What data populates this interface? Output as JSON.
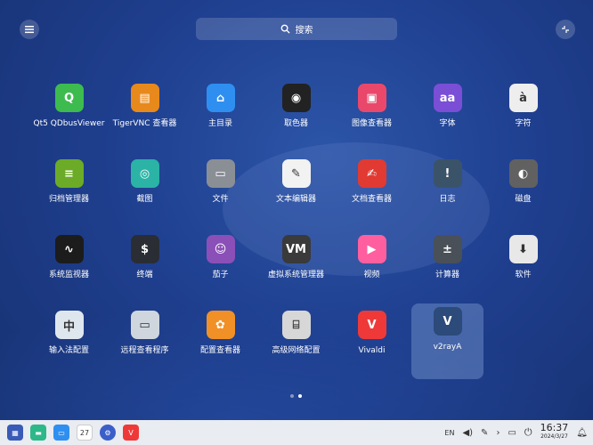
{
  "search": {
    "label": "搜索"
  },
  "apps": [
    {
      "label": "Qt5 QDbusViewer",
      "icon": "qt-icon",
      "color": "#3dbb4f",
      "glyph": "Q"
    },
    {
      "label": "TigerVNC 查看器",
      "icon": "tigervnc-icon",
      "color": "#e8891c",
      "glyph": "▤"
    },
    {
      "label": "主目录",
      "icon": "home-folder-icon",
      "color": "#2f8ff0",
      "glyph": "⌂"
    },
    {
      "label": "取色器",
      "icon": "color-picker-icon",
      "color": "#222222",
      "glyph": "◉"
    },
    {
      "label": "图像查看器",
      "icon": "image-viewer-icon",
      "color": "#e9486b",
      "glyph": "▣"
    },
    {
      "label": "字体",
      "icon": "font-icon",
      "color": "#7a4fd6",
      "glyph": "aa"
    },
    {
      "label": "字符",
      "icon": "character-map-icon",
      "color": "#eeeeee",
      "glyph": "à"
    },
    {
      "label": "归档管理器",
      "icon": "archive-manager-icon",
      "color": "#6cab27",
      "glyph": "≡"
    },
    {
      "label": "截图",
      "icon": "screenshot-icon",
      "color": "#2bb3a6",
      "glyph": "◎"
    },
    {
      "label": "文件",
      "icon": "files-icon",
      "color": "#8a8f96",
      "glyph": "▭"
    },
    {
      "label": "文本编辑器",
      "icon": "text-editor-icon",
      "color": "#f2f2f2",
      "glyph": "✎"
    },
    {
      "label": "文档查看器",
      "icon": "document-viewer-icon",
      "color": "#e13a33",
      "glyph": "✍"
    },
    {
      "label": "日志",
      "icon": "logs-icon",
      "color": "#3b5368",
      "glyph": "!"
    },
    {
      "label": "磁盘",
      "icon": "disks-icon",
      "color": "#616161",
      "glyph": "◐"
    },
    {
      "label": "系统监视器",
      "icon": "system-monitor-icon",
      "color": "#1c1c1c",
      "glyph": "∿"
    },
    {
      "label": "终端",
      "icon": "terminal-icon",
      "color": "#2a2d33",
      "glyph": "$"
    },
    {
      "label": "茄子",
      "icon": "cheese-icon",
      "color": "#8b4fb8",
      "glyph": "☺"
    },
    {
      "label": "虚拟系统管理器",
      "icon": "virt-manager-icon",
      "color": "#3a3a3a",
      "glyph": "VM"
    },
    {
      "label": "视频",
      "icon": "videos-icon",
      "color": "#ff5f9e",
      "glyph": "▶"
    },
    {
      "label": "计算器",
      "icon": "calculator-icon",
      "color": "#495057",
      "glyph": "±"
    },
    {
      "label": "软件",
      "icon": "software-icon",
      "color": "#e8e8e8",
      "glyph": "⬇"
    },
    {
      "label": "输入法配置",
      "icon": "input-method-icon",
      "color": "#dfe7ee",
      "glyph": "中"
    },
    {
      "label": "远程查看程序",
      "icon": "remote-viewer-icon",
      "color": "#cfd6de",
      "glyph": "▭"
    },
    {
      "label": "配置查看器",
      "icon": "config-viewer-icon",
      "color": "#f19027",
      "glyph": "✿"
    },
    {
      "label": "高级网络配置",
      "icon": "network-config-icon",
      "color": "#d7d7d7",
      "glyph": "⌸"
    },
    {
      "label": "Vivaldi",
      "icon": "vivaldi-icon",
      "color": "#ef3939",
      "glyph": "V"
    },
    {
      "label": "v2rayA",
      "icon": "v2raya-icon",
      "color": "#2c4a7a",
      "glyph": "V"
    }
  ],
  "selected_index": 26,
  "taskbar": {
    "calendar_day": "27",
    "lang": "EN",
    "time": "16:37",
    "date": "2024/3/27"
  }
}
